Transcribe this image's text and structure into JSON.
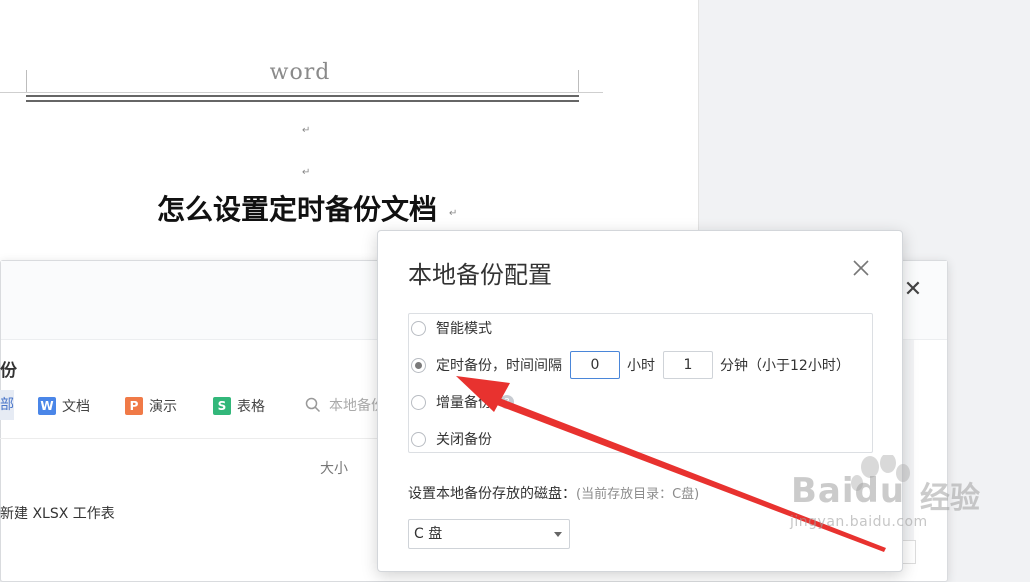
{
  "document": {
    "header_text": "word",
    "title": "怎么设置定时备份文档"
  },
  "background_panel": {
    "section_title": "份",
    "filters": [
      {
        "label": "部",
        "badge": ""
      },
      {
        "label": "文档",
        "badge": "W",
        "color": "#4a86e8"
      },
      {
        "label": "演示",
        "badge": "P",
        "color": "#f07a47"
      },
      {
        "label": "表格",
        "badge": "S",
        "color": "#32b77a"
      }
    ],
    "search_placeholder": "本地备份",
    "column_size": "大小",
    "rows": [
      "新建 XLSX 工作表"
    ]
  },
  "dialog": {
    "title": "本地备份配置",
    "options": [
      {
        "label": "智能模式",
        "selected": false
      },
      {
        "label": "定时备份，时间间隔",
        "selected": true
      },
      {
        "label": "增量备份",
        "selected": false
      },
      {
        "label": "关闭备份",
        "selected": false
      }
    ],
    "hours_value": "0",
    "hours_unit": "小时",
    "minutes_value": "1",
    "minutes_unit": "分钟（小于12小时）",
    "disk_label": "设置本地备份存放的磁盘：",
    "disk_hint": "(当前存放目录：C盘)",
    "disk_selected": "C 盘"
  },
  "watermark": {
    "brand": "Bai",
    "brand2": "du",
    "cn": "经验",
    "url": "jingyan.baidu.com"
  },
  "colors": {
    "arrow": "#e8322f",
    "accent": "#4a86d9"
  }
}
